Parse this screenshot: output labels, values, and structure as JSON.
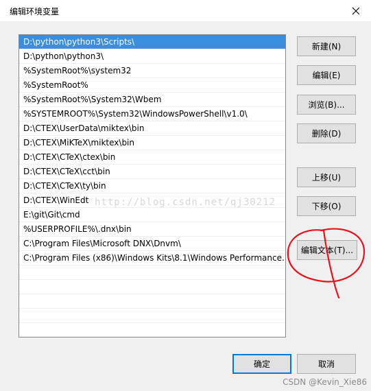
{
  "window": {
    "title": "编辑环境变量",
    "close_icon": "close-icon"
  },
  "list": {
    "items": [
      "D:\\python\\python3\\Scripts\\",
      "D:\\python\\python3\\",
      "%SystemRoot%\\system32",
      "%SystemRoot%",
      "%SystemRoot%\\System32\\Wbem",
      "%SYSTEMROOT%\\System32\\WindowsPowerShell\\v1.0\\",
      "D:\\CTEX\\UserData\\miktex\\bin",
      "D:\\CTEX\\MiKTeX\\miktex\\bin",
      "D:\\CTEX\\CTeX\\ctex\\bin",
      "D:\\CTEX\\CTeX\\cct\\bin",
      "D:\\CTEX\\CTeX\\ty\\bin",
      "D:\\CTEX\\WinEdt",
      "E:\\git\\Git\\cmd",
      "%USERPROFILE%\\.dnx\\bin",
      "C:\\Program Files\\Microsoft DNX\\Dnvm\\",
      "C:\\Program Files (x86)\\Windows Kits\\8.1\\Windows Performance..."
    ],
    "selected_index": 0
  },
  "buttons": {
    "new": "新建(N)",
    "edit": "编辑(E)",
    "browse": "浏览(B)...",
    "delete": "删除(D)",
    "move_up": "上移(U)",
    "move_down": "下移(O)",
    "edit_text": "编辑文本(T)...",
    "ok": "确定",
    "cancel": "取消"
  },
  "watermark": "http://blog.csdn.net/qj30212",
  "footer_credit": "CSDN @Kevin_Xie86",
  "colors": {
    "selection": "#3b8ddd",
    "annotation": "#e8101a",
    "primary_border": "#0078d7"
  }
}
